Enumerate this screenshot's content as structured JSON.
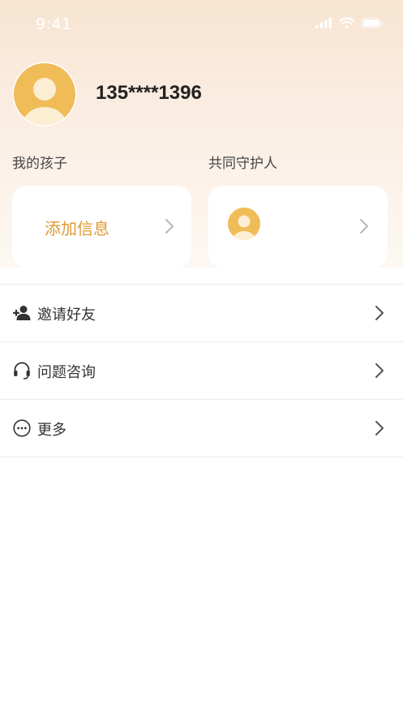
{
  "status_bar": {
    "time": "9:41",
    "icons": [
      "signal-icon",
      "wifi-icon",
      "battery-icon"
    ]
  },
  "profile": {
    "phone": "135****1396",
    "avatar_icon": "user-avatar-icon"
  },
  "sections": {
    "my_children": {
      "label": "我的孩子",
      "card_text": "添加信息"
    },
    "co_guardian": {
      "label": "共同守护人",
      "avatar_icon": "user-avatar-icon"
    }
  },
  "menu": [
    {
      "label": "邀请好友",
      "icon": "add-user-icon"
    },
    {
      "label": "问题咨询",
      "icon": "headset-icon"
    },
    {
      "label": "更多",
      "icon": "more-icon"
    }
  ],
  "colors": {
    "accent": "#e09a35",
    "avatar": "#f0bc58",
    "header_gradient_top": "#f8e5d2"
  }
}
